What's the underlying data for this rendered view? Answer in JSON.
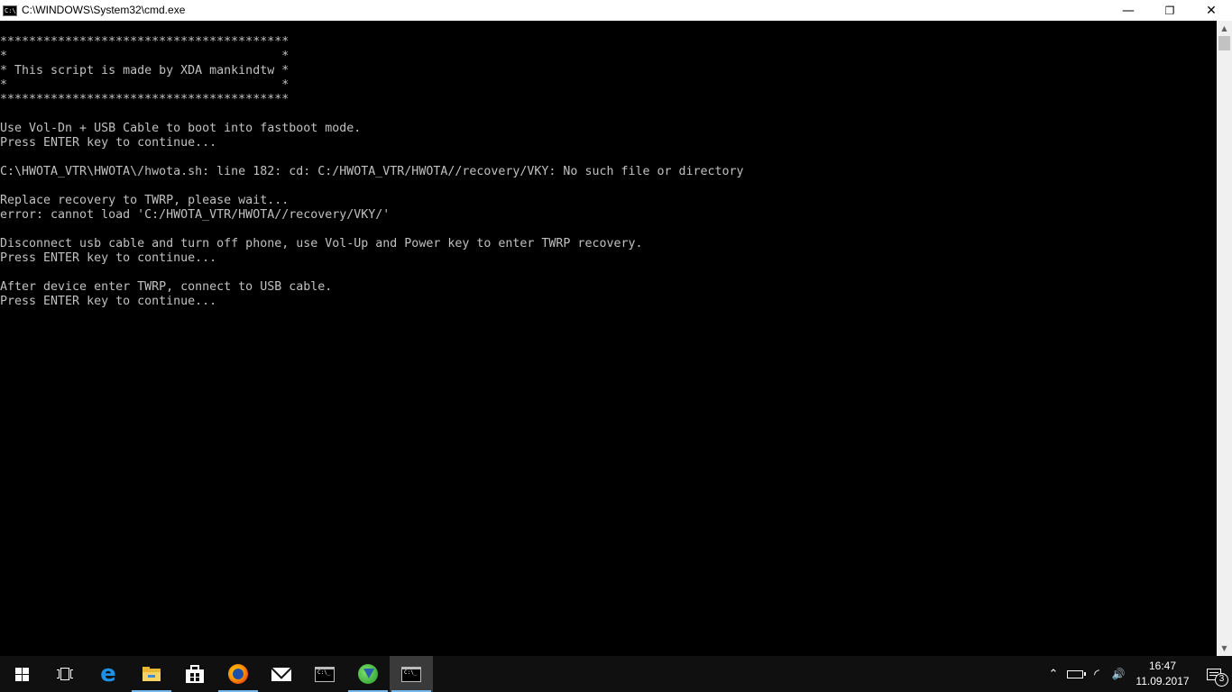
{
  "window": {
    "title": "C:\\WINDOWS\\System32\\cmd.exe",
    "icon_label": "C:\\",
    "controls": {
      "minimize": "—",
      "restore": "❐",
      "close": "✕"
    }
  },
  "console": {
    "lines": [
      "****************************************",
      "*                                      *",
      "* This script is made by XDA mankindtw *",
      "*                                      *",
      "****************************************",
      "",
      "Use Vol-Dn + USB Cable to boot into fastboot mode.",
      "Press ENTER key to continue...",
      "",
      "C:\\HWOTA_VTR\\HWOTA\\/hwota.sh: line 182: cd: C:/HWOTA_VTR/HWOTA//recovery/VKY: No such file or directory",
      "",
      "Replace recovery to TWRP, please wait...",
      "error: cannot load 'C:/HWOTA_VTR/HWOTA//recovery/VKY/'",
      "",
      "Disconnect usb cable and turn off phone, use Vol-Up and Power key to enter TWRP recovery.",
      "Press ENTER key to continue...",
      "",
      "After device enter TWRP, connect to USB cable.",
      "Press ENTER key to continue..."
    ]
  },
  "scrollbar": {
    "up": "▲",
    "down": "▼"
  },
  "taskbar": {
    "apps": [
      {
        "name": "start-button",
        "icon": "windows-logo-icon"
      },
      {
        "name": "task-view-button",
        "icon": "task-view-icon"
      },
      {
        "name": "edge-button",
        "icon": "edge-icon",
        "glyph": "e"
      },
      {
        "name": "file-explorer-button",
        "icon": "folder-icon",
        "running": true
      },
      {
        "name": "store-button",
        "icon": "store-icon"
      },
      {
        "name": "firefox-button",
        "icon": "firefox-icon",
        "running": true
      },
      {
        "name": "mail-button",
        "icon": "mail-icon"
      },
      {
        "name": "cmd-button",
        "icon": "cmd-icon",
        "glyph": "C:\\_"
      },
      {
        "name": "green-app-button",
        "icon": "green-app-icon",
        "running": true
      },
      {
        "name": "cmd-active-button",
        "icon": "cmd-icon",
        "glyph": "C:\\_",
        "running": true,
        "active": true
      }
    ],
    "tray": {
      "chevron": "⌃",
      "wifi": "◜",
      "volume": "🔊",
      "time": "16:47",
      "date": "11.09.2017",
      "notification_count": "3"
    }
  }
}
